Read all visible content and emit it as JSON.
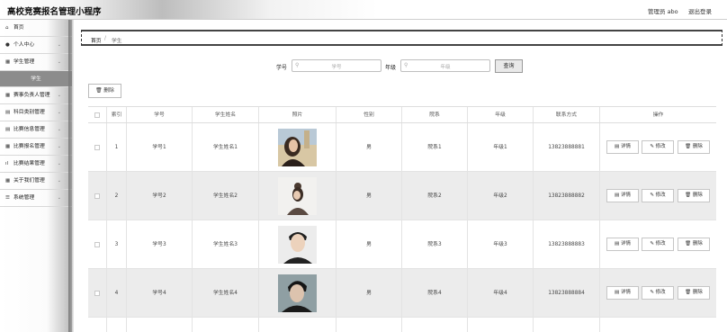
{
  "header": {
    "title": "高校竞赛报名管理小程序",
    "admin": "管理员 abo",
    "logout": "退出登录"
  },
  "sidebar": {
    "items": [
      {
        "icon": "⌂",
        "label": "首页"
      },
      {
        "icon": "●",
        "label": "个人中心",
        "chevron": "⌄"
      },
      {
        "icon": "▦",
        "label": "学生管理",
        "chevron": "⌄"
      },
      {
        "icon": "▦",
        "label": "赛事负责人管理",
        "chevron": "⌄"
      },
      {
        "icon": "▤",
        "label": "科目类别管理",
        "chevron": "⌄"
      },
      {
        "icon": "▤",
        "label": "比赛信息管理",
        "chevron": "⌄"
      },
      {
        "icon": "▦",
        "label": "比赛报名管理",
        "chevron": "⌄"
      },
      {
        "icon": "ıl",
        "label": "比赛结果管理",
        "chevron": "⌄"
      },
      {
        "icon": "▦",
        "label": "关于我们管理",
        "chevron": "⌄"
      },
      {
        "icon": "☰",
        "label": "系统管理",
        "chevron": "⌄"
      }
    ],
    "sub_active": "学生"
  },
  "breadcrumb": {
    "home": "首页",
    "sep": "/",
    "current": "学生"
  },
  "search": {
    "field1_label": "学号",
    "field1_placeholder": "学号",
    "field2_label": "年级",
    "field2_placeholder": "年级",
    "button": "查询",
    "search_icon": "⚲"
  },
  "toolbar": {
    "delete_label": "删除",
    "delete_icon": "🗑"
  },
  "table": {
    "headers": [
      "",
      "索引",
      "学号",
      "学生姓名",
      "照片",
      "性别",
      "院系",
      "年级",
      "联系方式",
      "操作"
    ],
    "rows": [
      {
        "index": "1",
        "xuehao": "学号1",
        "name": "学生姓名1",
        "gender": "男",
        "dept": "院系1",
        "grade": "年级1",
        "phone": "13823888881"
      },
      {
        "index": "2",
        "xuehao": "学号2",
        "name": "学生姓名2",
        "gender": "男",
        "dept": "院系2",
        "grade": "年级2",
        "phone": "13823888882"
      },
      {
        "index": "3",
        "xuehao": "学号3",
        "name": "学生姓名3",
        "gender": "男",
        "dept": "院系3",
        "grade": "年级3",
        "phone": "13823888883"
      },
      {
        "index": "4",
        "xuehao": "学号4",
        "name": "学生姓名4",
        "gender": "男",
        "dept": "院系4",
        "grade": "年级4",
        "phone": "13823888884"
      }
    ],
    "actions": {
      "detail": "详情",
      "edit": "修改",
      "delete": "删除"
    }
  }
}
